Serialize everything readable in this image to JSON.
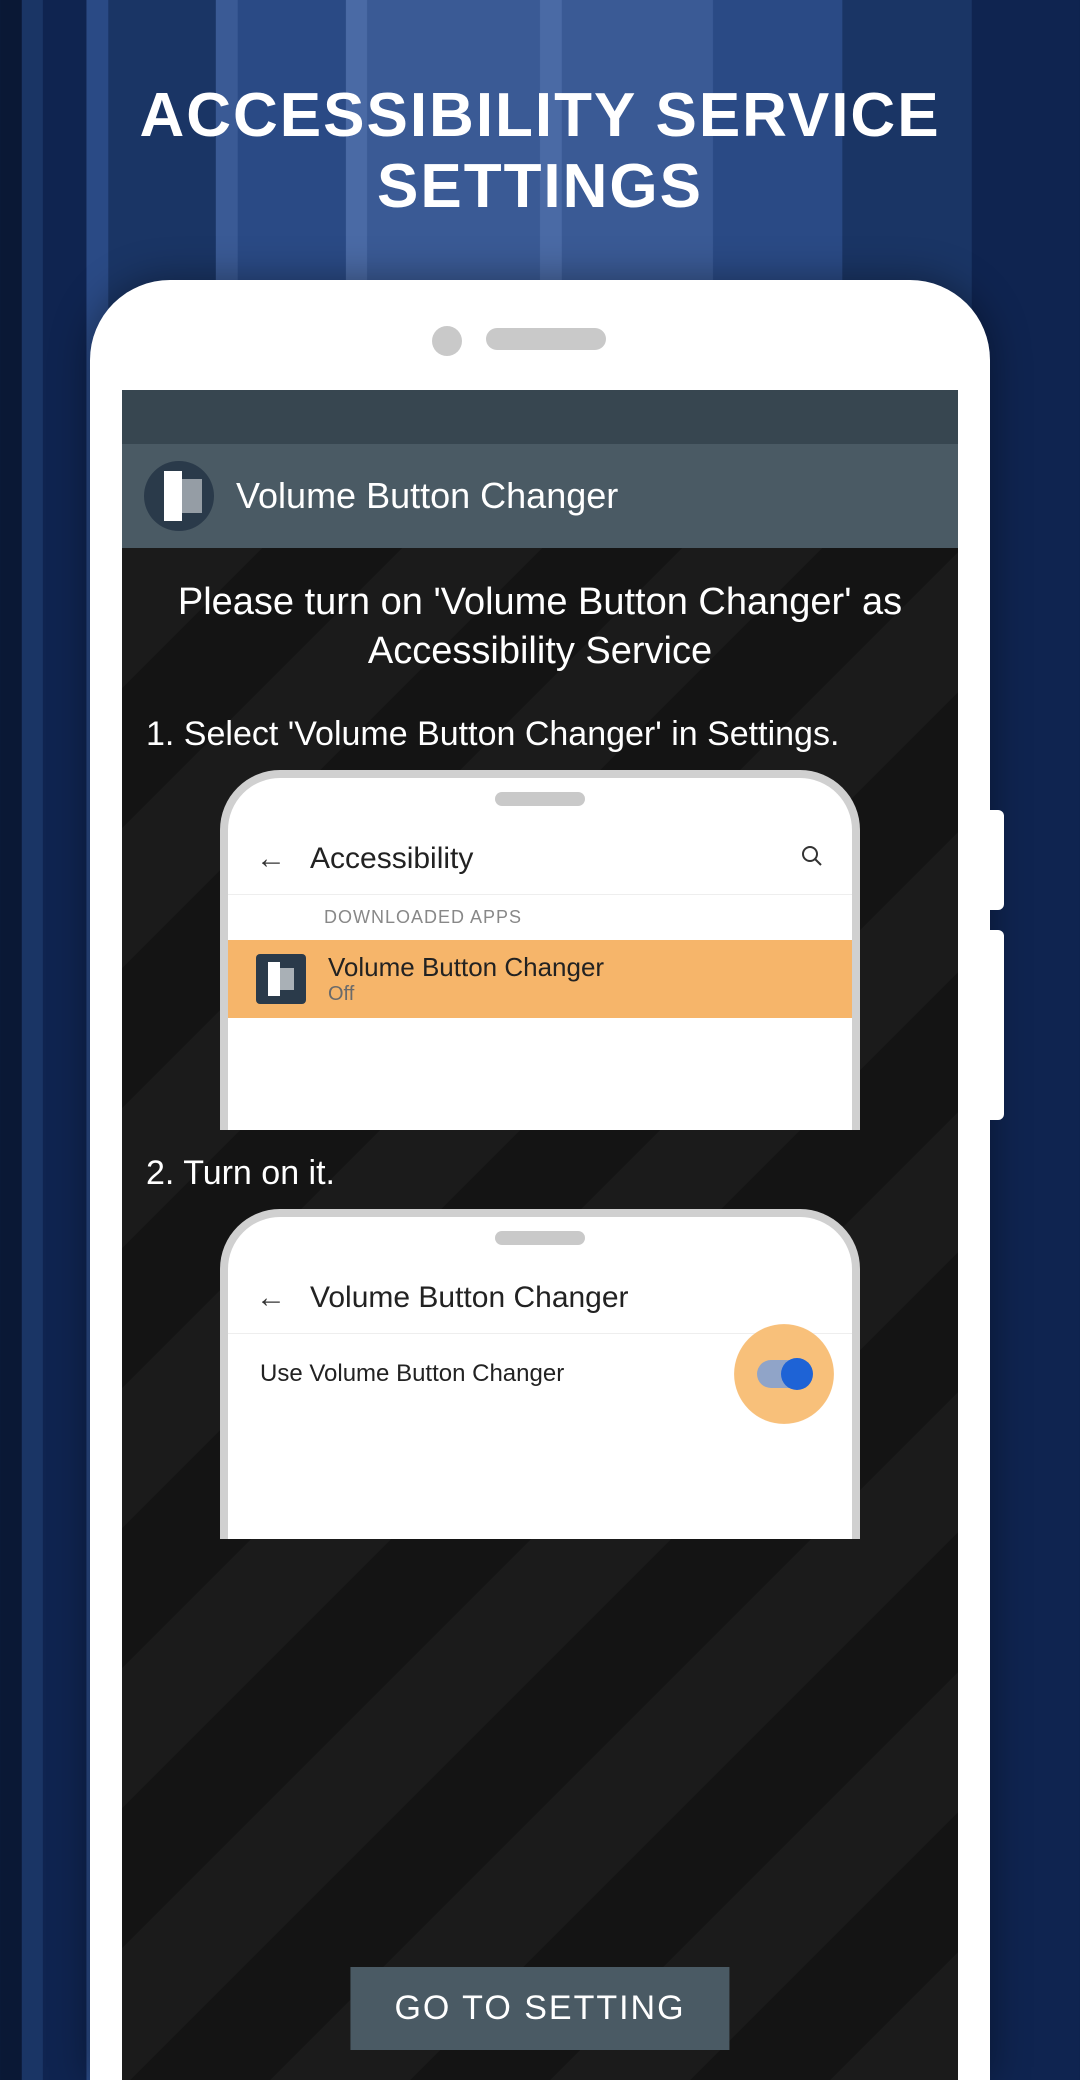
{
  "page_title": "ACCESSIBILITY SERVICE\nSETTINGS",
  "app": {
    "title": "Volume Button Changer"
  },
  "instruction": {
    "heading": "Please turn on 'Volume Button Changer' as Accessibility Service",
    "step1": "1. Select 'Volume Button Changer' in Settings.",
    "step2": "2. Turn on it."
  },
  "mini1": {
    "header": "Accessibility",
    "section": "DOWNLOADED APPS",
    "item_title": "Volume Button Changer",
    "item_status": "Off"
  },
  "mini2": {
    "header": "Volume Button Changer",
    "row_label": "Use Volume Button Changer"
  },
  "cta_label": "GO TO SETTING"
}
